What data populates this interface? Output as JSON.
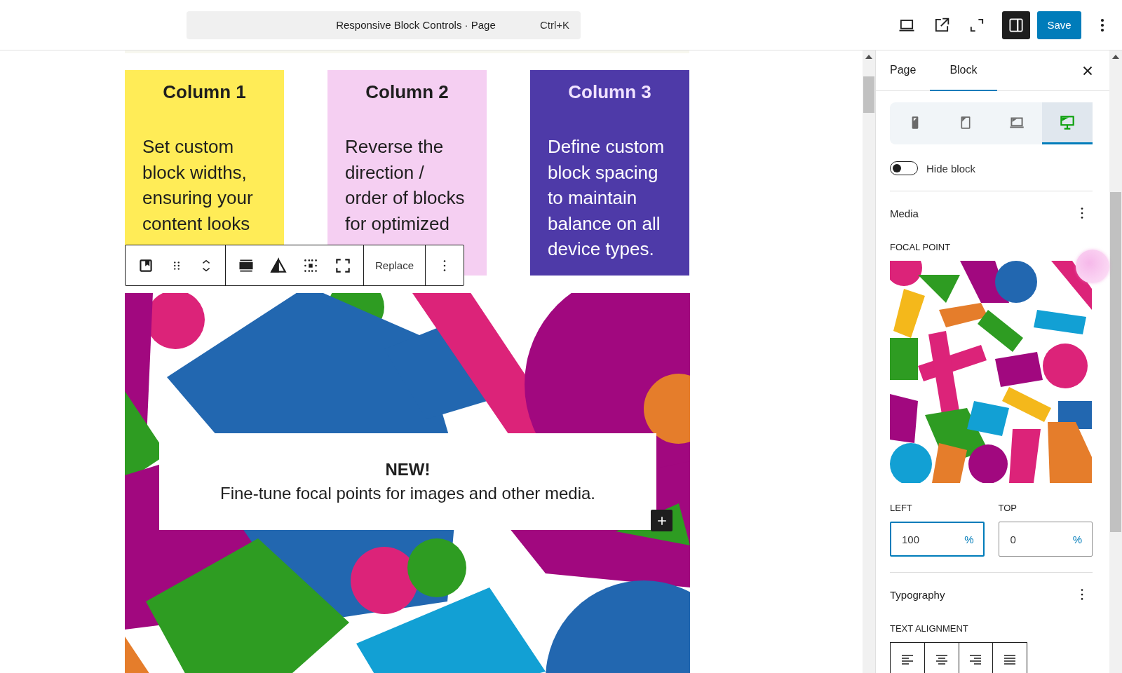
{
  "header": {
    "command_title": "Responsive Block Controls · Page",
    "shortcut": "Ctrl+K",
    "sidebar_open": true,
    "save_label": "Save"
  },
  "columns": [
    {
      "heading": "Column 1",
      "text": "Set custom block widths, ensuring your content looks",
      "color": "#ffec57"
    },
    {
      "heading": "Column 2",
      "text": "Reverse the direction / order of blocks for optimized",
      "color": "#f5cff2"
    },
    {
      "heading": "Column 3",
      "text": "Define custom block spacing to maintain balance on all device types.",
      "color": "#4e3aa8"
    }
  ],
  "block_toolbar": {
    "replace_label": "Replace"
  },
  "cover": {
    "heading": "NEW!",
    "text": "Fine-tune focal points for images and other media."
  },
  "sidebar": {
    "tabs": [
      {
        "label": "Page",
        "selected": false
      },
      {
        "label": "Block",
        "selected": true
      }
    ],
    "devices": [
      {
        "kind": "mobile",
        "selected": false
      },
      {
        "kind": "tablet",
        "selected": false
      },
      {
        "kind": "laptop",
        "selected": false
      },
      {
        "kind": "desktop",
        "selected": true
      }
    ],
    "hide_block": {
      "label": "Hide block",
      "on": false
    },
    "media": {
      "title": "Media",
      "focal_label": "FOCAL POINT",
      "left": {
        "label": "LEFT",
        "value": "100",
        "unit": "%",
        "focused": true
      },
      "top": {
        "label": "TOP",
        "value": "0",
        "unit": "%",
        "focused": false
      }
    },
    "typography": {
      "title": "Typography",
      "alignment_label": "TEXT ALIGNMENT",
      "alignments": [
        {
          "kind": "left",
          "selected": false
        },
        {
          "kind": "center",
          "selected": false
        },
        {
          "kind": "right",
          "selected": false
        },
        {
          "kind": "justify",
          "selected": false
        }
      ]
    }
  }
}
